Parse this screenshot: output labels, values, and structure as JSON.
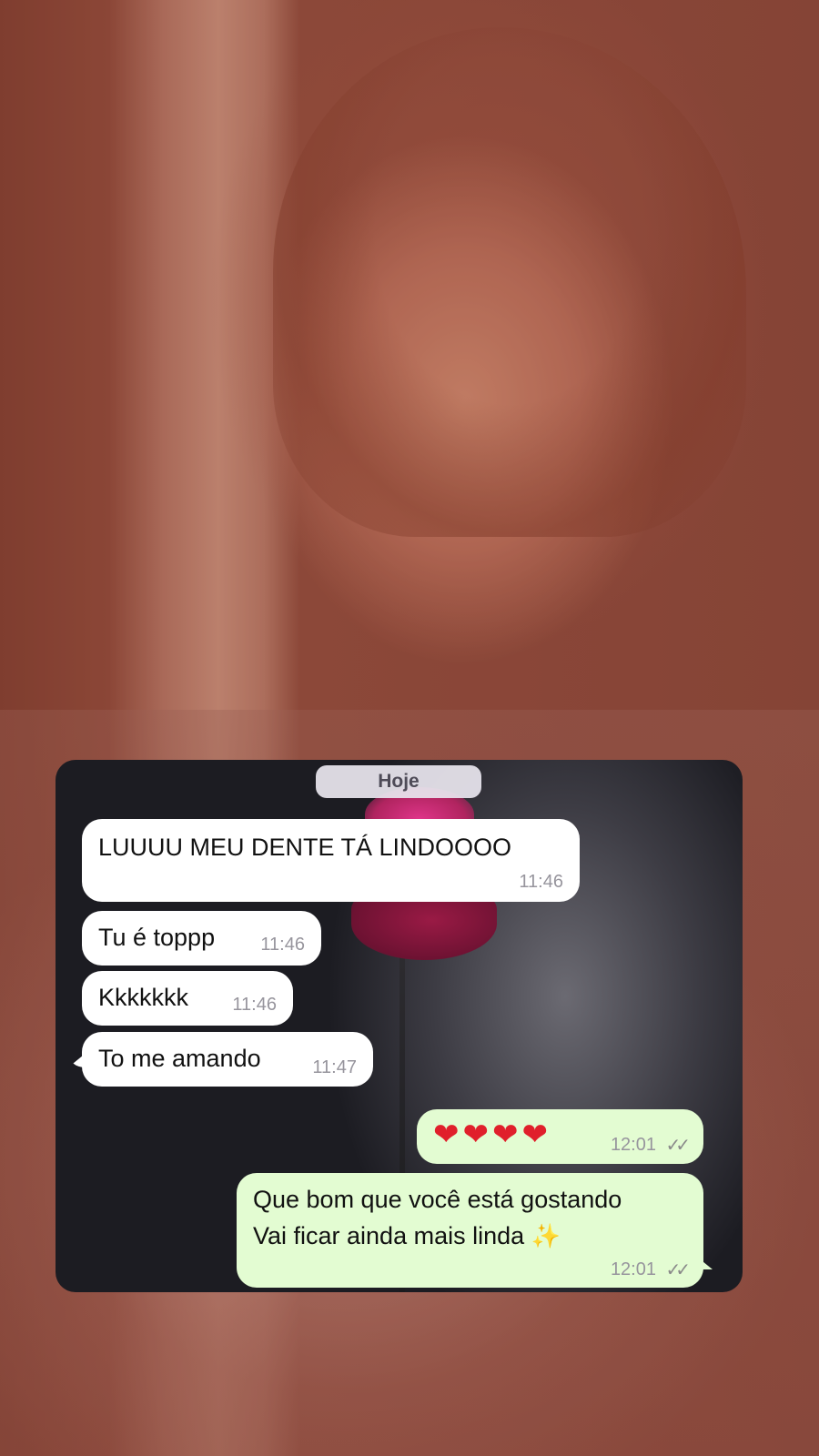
{
  "chat": {
    "date_label": "Hoje",
    "messages": [
      {
        "direction": "incoming",
        "text": "LUUUU MEU DENTE TÁ LINDOOOO",
        "time": "11:46"
      },
      {
        "direction": "incoming",
        "text": "Tu é toppp",
        "time": "11:46"
      },
      {
        "direction": "incoming",
        "text": "Kkkkkkk",
        "time": "11:46"
      },
      {
        "direction": "incoming",
        "text": "To me amando",
        "time": "11:47"
      },
      {
        "direction": "outgoing",
        "text": "❤❤❤❤",
        "time": "12:01",
        "status": "read"
      },
      {
        "direction": "outgoing",
        "line1": "Que bom que você está gostando",
        "line2": "Vai ficar ainda mais linda",
        "emoji": "✨",
        "time": "12:01",
        "status": "read"
      }
    ]
  },
  "icons": {
    "read_ticks": "✓✓"
  },
  "colors": {
    "incoming_bubble": "#ffffff",
    "outgoing_bubble": "#e3fcd2",
    "background_tint": "#8a4a3a"
  }
}
